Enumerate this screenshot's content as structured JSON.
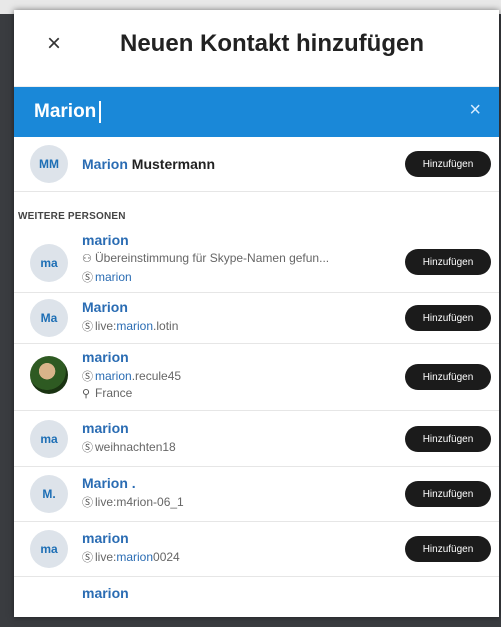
{
  "header": {
    "title": "Neuen Kontakt hinzufügen",
    "close_icon": "×"
  },
  "search": {
    "value": "Marion",
    "clear_icon": "×"
  },
  "top_result": {
    "initials": "MM",
    "name_highlight": "Marion",
    "name_rest": " Mustermann",
    "button": "Hinzufügen"
  },
  "section_label": "WEITERE PERSONEN",
  "people": [
    {
      "initials": "ma",
      "name": "marion",
      "line1": "Übereinstimmung für Skype-Namen gefun...",
      "line2": "marion",
      "button": "Hinzufügen"
    },
    {
      "initials": "Ma",
      "name": "Marion",
      "line1_prefix": "live:",
      "line1_highlight": "marion",
      "line1_suffix": ".lotin",
      "button": "Hinzufügen"
    },
    {
      "name": "marion",
      "line1_highlight": "marion",
      "line1_suffix": ".recule45",
      "line2": "France",
      "button": "Hinzufügen"
    },
    {
      "initials": "ma",
      "name": "marion",
      "line1": "weihnachten18",
      "button": "Hinzufügen"
    },
    {
      "initials": "M.",
      "name": "Marion .",
      "line1": "live:m4rion-06_1",
      "button": "Hinzufügen"
    },
    {
      "initials": "ma",
      "name": "marion",
      "line1_prefix": "live:",
      "line1_highlight": "marion",
      "line1_suffix": "0024",
      "button": "Hinzufügen"
    },
    {
      "name": "marion"
    }
  ],
  "colors": {
    "accent": "#1a88d8",
    "name": "#2a6cb3",
    "button": "#1b1b1b"
  }
}
